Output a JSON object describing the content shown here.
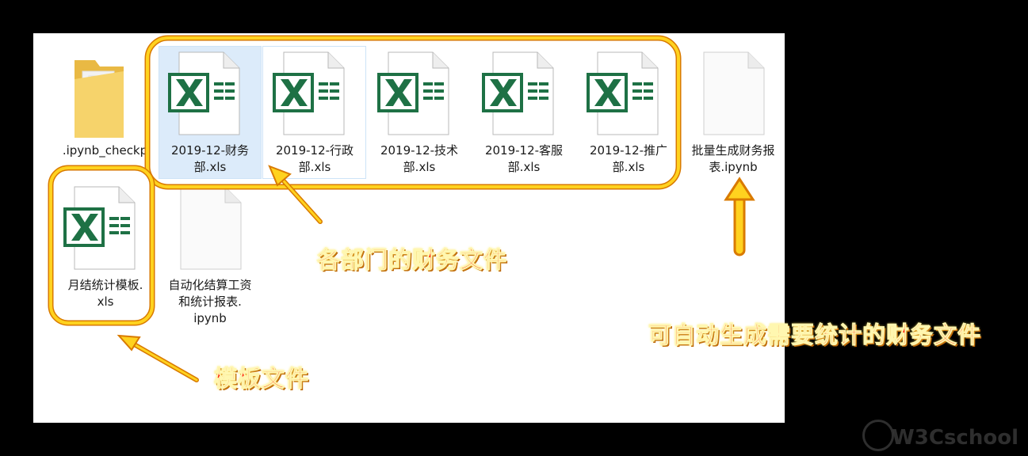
{
  "files": [
    {
      "name": ".ipynb_checkpoints",
      "type": "folder"
    },
    {
      "name": "2019-12-财务部.xls",
      "line1": "2019-12-财务",
      "line2": "部.xls",
      "type": "excel"
    },
    {
      "name": "2019-12-行政部.xls",
      "line1": "2019-12-行政",
      "line2": "部.xls",
      "type": "excel"
    },
    {
      "name": "2019-12-技术部.xls",
      "line1": "2019-12-技术",
      "line2": "部.xls",
      "type": "excel"
    },
    {
      "name": "2019-12-客服部.xls",
      "line1": "2019-12-客服",
      "line2": "部.xls",
      "type": "excel"
    },
    {
      "name": "2019-12-推广部.xls",
      "line1": "2019-12-推广",
      "line2": "部.xls",
      "type": "excel"
    },
    {
      "name": "批量生成财务报表.ipynb",
      "line1": "批量生成财务报",
      "line2": "表.ipynb",
      "type": "notebook"
    },
    {
      "name": "月结统计模板.xls",
      "line1": "月结统计模板.",
      "line2": "xls",
      "type": "excel"
    },
    {
      "name": "自动化结算工资和统计报表.ipynb",
      "line1": "自动化结算工资",
      "line2": "和统计报表.",
      "line3": "ipynb",
      "type": "notebook"
    }
  ],
  "folder_label_visible": ".ipynb_checkp",
  "annotations": {
    "departments": "各部门的财务文件",
    "template": "模板文件",
    "generated": "可自动生成需要统计的财务文件"
  },
  "watermark": "W3Cschool",
  "colors": {
    "excel_green": "#1e7145",
    "highlight_fill": "#dcebfa",
    "annotation_text": "#ff1a0a",
    "annotation_outline": "#ffd21f",
    "callout_border": "#ffb800"
  }
}
